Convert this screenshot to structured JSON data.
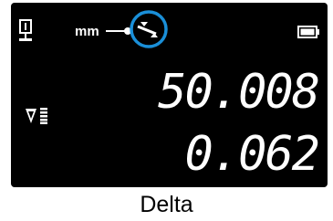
{
  "display": {
    "unit": "mm",
    "main_value": "50.008",
    "delta_value": "0.062",
    "highlight_color": "#1a8fd8",
    "icons": [
      "probe-icon",
      "unit-link-icon",
      "delta-mode-icon",
      "battery-icon",
      "delta-symbol-icon",
      "bar-level-icon"
    ]
  },
  "caption": "Delta"
}
